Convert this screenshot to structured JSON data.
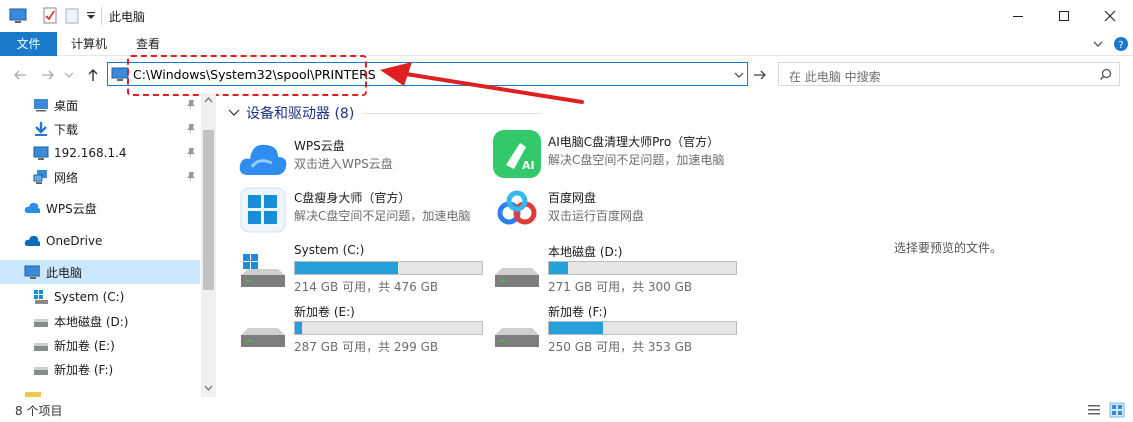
{
  "window": {
    "title": "此电脑"
  },
  "ribbon": {
    "tabs": [
      {
        "label": "文件"
      },
      {
        "label": "计算机"
      },
      {
        "label": "查看"
      }
    ]
  },
  "address": {
    "path": "C:\\Windows\\System32\\spool\\PRINTERS"
  },
  "search": {
    "placeholder": "在 此电脑 中搜索"
  },
  "sidebar": {
    "items": [
      {
        "label": "桌面"
      },
      {
        "label": "下载"
      },
      {
        "label": "192.168.1.4"
      },
      {
        "label": "网络"
      },
      {
        "label": "WPS云盘"
      },
      {
        "label": "OneDrive"
      },
      {
        "label": "此电脑"
      },
      {
        "label": "System (C:)"
      },
      {
        "label": "本地磁盘 (D:)"
      },
      {
        "label": "新加卷 (E:)"
      },
      {
        "label": "新加卷 (F:)"
      }
    ]
  },
  "content": {
    "group_title": "设备和驱动器 (8)",
    "apps": [
      {
        "name": "WPS云盘",
        "desc": "双击进入WPS云盘"
      },
      {
        "name": "AI电脑C盘清理大师Pro（官方）",
        "desc": "解决C盘空间不足问题，加速电脑"
      },
      {
        "name": "C盘瘦身大师（官方）",
        "desc": "解决C盘空间不足问题，加速电脑"
      },
      {
        "name": "百度网盘",
        "desc": "双击运行百度网盘"
      }
    ],
    "drives": [
      {
        "name": "System (C:)",
        "space": "214 GB 可用，共 476 GB",
        "used_fraction": 0.55
      },
      {
        "name": "本地磁盘 (D:)",
        "space": "271 GB 可用，共 300 GB",
        "used_fraction": 0.1
      },
      {
        "name": "新加卷 (E:)",
        "space": "287 GB 可用，共 299 GB",
        "used_fraction": 0.04
      },
      {
        "name": "新加卷 (F:)",
        "space": "250 GB 可用，共 353 GB",
        "used_fraction": 0.29
      }
    ]
  },
  "preview": {
    "text": "选择要预览的文件。"
  },
  "status": {
    "count": "8 个项目"
  },
  "colors": {
    "accent": "#1979ca",
    "bar_fill": "#26a0da",
    "annotation": "#e02020"
  }
}
